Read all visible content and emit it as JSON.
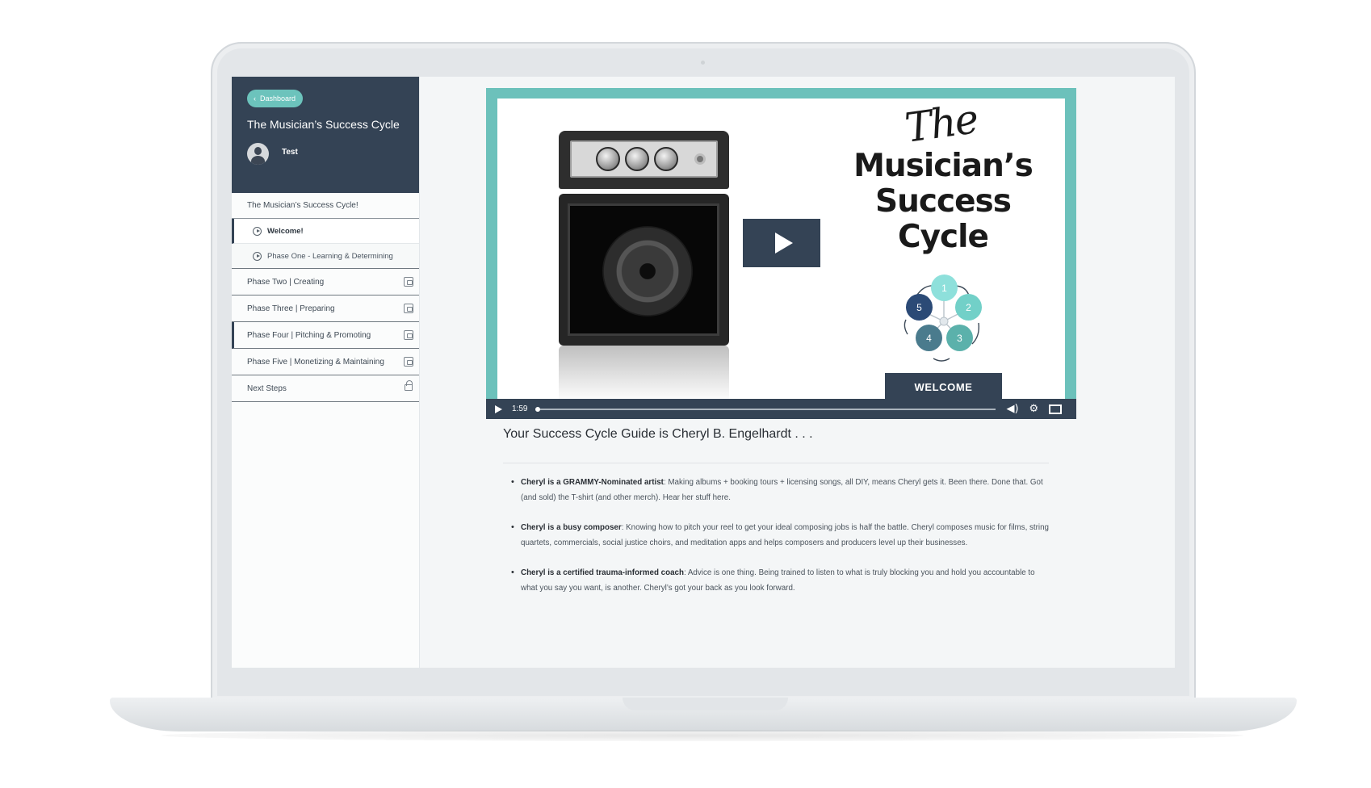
{
  "sidebar": {
    "back_label": "Dashboard",
    "course_title": "The Musician’s Success Cycle",
    "user_name": "Test",
    "items": [
      {
        "label": "The Musician’s Success Cycle!"
      },
      {
        "label": "Welcome!"
      },
      {
        "label": "Phase One - Learning & Determining"
      },
      {
        "label": "Phase Two | Creating"
      },
      {
        "label": "Phase Three | Preparing"
      },
      {
        "label": "Phase Four | Pitching & Promoting"
      },
      {
        "label": "Phase Five | Monetizing & Maintaining"
      },
      {
        "label": "Next Steps"
      }
    ]
  },
  "video": {
    "slide": {
      "script": "The",
      "title_lines": [
        "Musician’s",
        "Success",
        "Cycle"
      ],
      "cycle_nodes": [
        "1",
        "2",
        "3",
        "4",
        "5"
      ],
      "badge": "WELCOME"
    },
    "time": "1:59",
    "progress": 0.0,
    "colors": {
      "frame": "#6cc1bb",
      "navy": "#344355"
    }
  },
  "content": {
    "title": "Your Success Cycle Guide is Cheryl B. Engelhardt . . .",
    "bullets": [
      {
        "bold": "Cheryl is a GRAMMY-Nominated artist",
        "text": ": Making albums + booking tours + licensing songs, all DIY, means Cheryl gets it. Been there. Done that. Got (and sold) the T-shirt (and other merch). Hear her stuff here."
      },
      {
        "bold": "Cheryl is a busy composer",
        "text": ": Knowing how to pitch your reel to get your ideal composing jobs is half the battle. Cheryl composes music for films, string quartets, commercials, social justice choirs, and meditation apps and helps composers and producers level up their businesses."
      },
      {
        "bold": "Cheryl is a certified trauma-informed coach",
        "text": ": Advice is one thing. Being trained to listen to what is truly blocking you and hold you accountable to what you say you want, is another. Cheryl’s got your back as you look forward."
      }
    ]
  }
}
